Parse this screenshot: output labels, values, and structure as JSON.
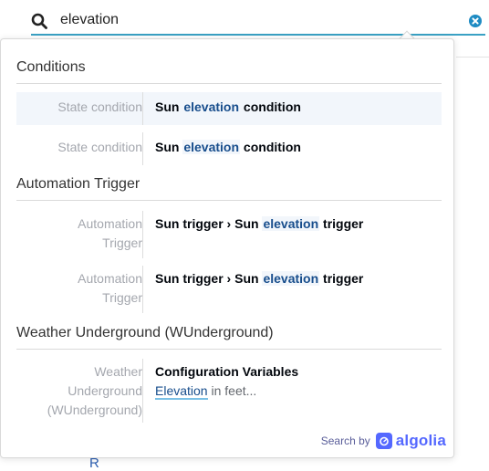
{
  "search": {
    "value": "elevation"
  },
  "background": {
    "partial_text": "R"
  },
  "results": {
    "conditions": {
      "title": "Conditions",
      "items": [
        {
          "category": "State condition",
          "before": "Sun ",
          "highlight": "elevation",
          "after": " condition"
        },
        {
          "category": "State condition",
          "before": "Sun ",
          "highlight": "elevation",
          "after": " condition"
        }
      ]
    },
    "automation": {
      "title": "Automation Trigger",
      "items": [
        {
          "category_line1": "Automation",
          "category_line2": "Trigger",
          "before": "Sun trigger › Sun ",
          "highlight": "elevation",
          "after": " trigger"
        },
        {
          "category_line1": "Automation",
          "category_line2": "Trigger",
          "before": "Sun trigger › Sun ",
          "highlight": "elevation",
          "after": " trigger"
        }
      ]
    },
    "weather": {
      "title": "Weather Underground (WUnderground)",
      "items": [
        {
          "category_line1": "Weather",
          "category_line2": "Underground",
          "category_line3": "(WUnderground)",
          "title": "Configuration Variables",
          "snippet_highlight": "Elevation",
          "snippet_after": " in feet..."
        }
      ]
    }
  },
  "footer": {
    "label": "Search by",
    "brand": "algolia"
  },
  "colors": {
    "accent": "#3aa1c4",
    "highlight_text": "#174d8c",
    "brand": "#5468ff"
  }
}
